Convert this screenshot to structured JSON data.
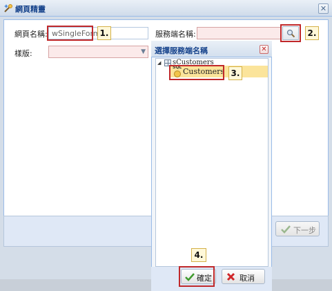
{
  "window": {
    "title": "網頁精靈",
    "close_symbol": "✕"
  },
  "form": {
    "page_name_label": "網頁名稱:",
    "page_name_value": "wSingleForm",
    "service_name_label": "服務端名稱:",
    "template_label": "樣版:"
  },
  "footer": {
    "next_label": "下一步"
  },
  "dialog": {
    "title": "選擇服務端名稱",
    "close_symbol": "✕",
    "tree": {
      "root_label": "sCustomers",
      "child_label": "Customers",
      "child_icon_text": "SQL"
    },
    "ok_label": "確定",
    "cancel_label": "取消"
  },
  "steps": {
    "s1": "1.",
    "s2": "2.",
    "s3": "3.",
    "s4": "4."
  },
  "colors": {
    "callout": "#c0282a",
    "selection": "#fbe49b",
    "title_text": "#15428b"
  }
}
